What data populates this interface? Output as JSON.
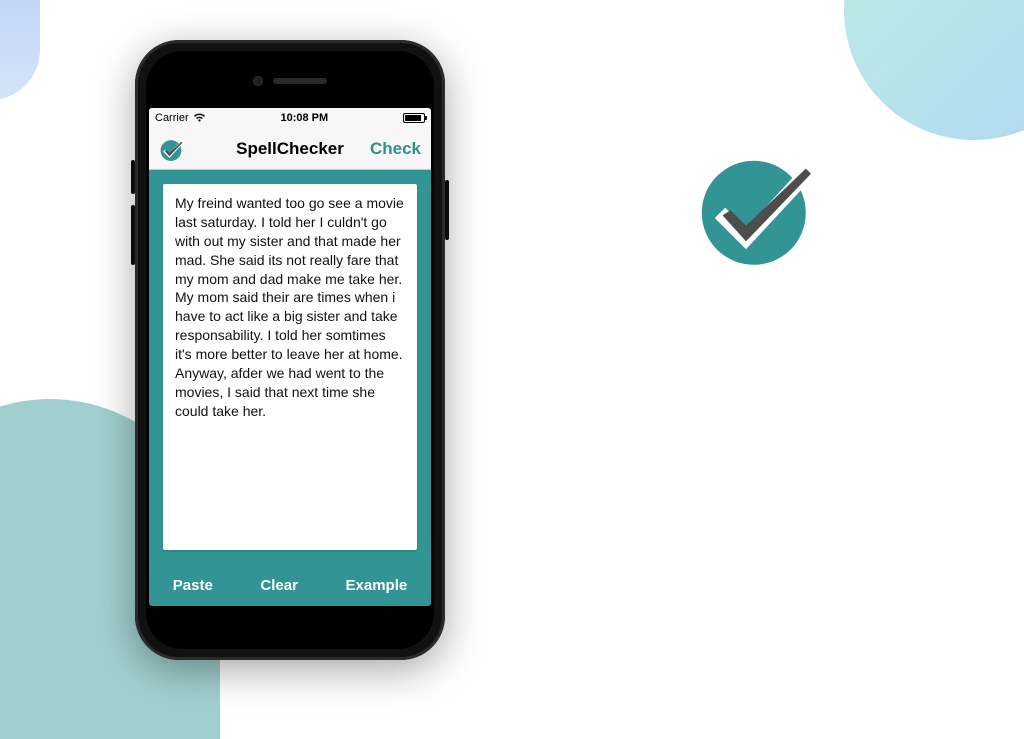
{
  "statusbar": {
    "carrier": "Carrier",
    "time": "10:08 PM"
  },
  "navbar": {
    "title": "SpellChecker",
    "action": "Check"
  },
  "content": {
    "text": "My freind wanted too go see a movie last saturday. I told her I culdn't go with out my sister and that made her mad. She said its not really fare that my mom and dad make me take her. My mom said their are times when i have to act like a big sister and take responsability. I told her somtimes it's more better to leave her at home. Anyway, afder we had went to the movies, I said that next time she could take her."
  },
  "toolbar": {
    "paste": "Paste",
    "clear": "Clear",
    "example": "Example"
  },
  "icons": {
    "app_logo": "checkmark-circle",
    "wifi": "wifi-icon",
    "battery": "battery-icon"
  },
  "colors": {
    "accent": "#329494",
    "action_text": "#2f8f8f"
  }
}
